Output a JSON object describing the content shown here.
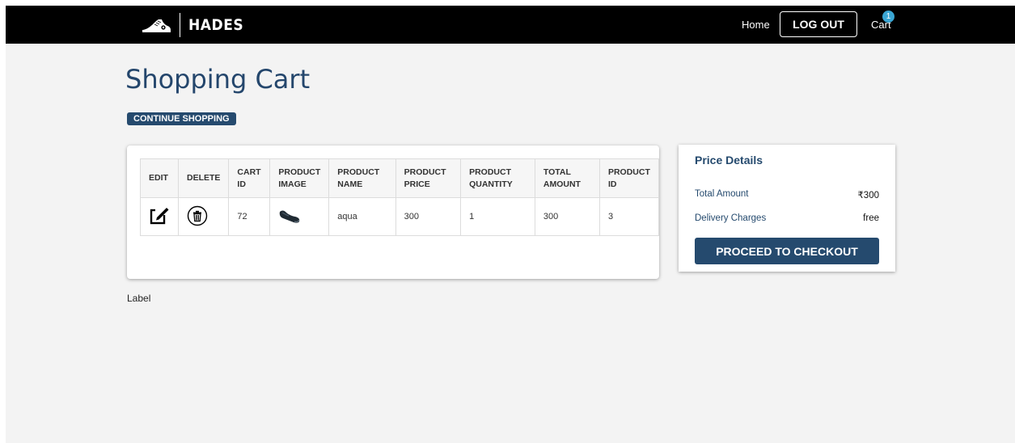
{
  "nav": {
    "brand_name": "HADES",
    "brand_logo_icon": "sneaker-icon",
    "home_label": "Home",
    "logout_label": "LOG OUT",
    "cart_label": "Cart",
    "cart_count": "1"
  },
  "page": {
    "title": "Shopping Cart",
    "continue_label": "CONTINUE SHOPPING",
    "footer_label": "Label"
  },
  "cart_table": {
    "headers": {
      "edit": "EDIT",
      "delete": "DELETE",
      "cart_id": "CART ID",
      "product_image": "PRODUCT IMAGE",
      "product_name": "PRODUCT NAME",
      "product_price": "PRODUCT PRICE",
      "product_quantity": "PRODUCT QUANTITY",
      "total_amount": "TOTAL AMOUNT",
      "product_id": "PRODUCT ID"
    },
    "rows": [
      {
        "edit_icon": "edit-icon",
        "delete_icon": "trash-icon",
        "cart_id": "72",
        "product_image_icon": "shoe-icon",
        "product_name": "aqua",
        "product_price": "300",
        "product_quantity": "1",
        "total_amount": "300",
        "product_id": "3"
      }
    ]
  },
  "price_details": {
    "title": "Price Details",
    "total_amount_label": "Total Amount",
    "total_amount_value": "₹300",
    "delivery_label": "Delivery Charges",
    "delivery_value": "free",
    "checkout_label": "PROCEED TO CHECKOUT"
  },
  "colors": {
    "navbar_bg": "#000000",
    "accent": "#254a6e",
    "page_bg": "#f3f3f3",
    "badge": "#3aa6d4"
  }
}
